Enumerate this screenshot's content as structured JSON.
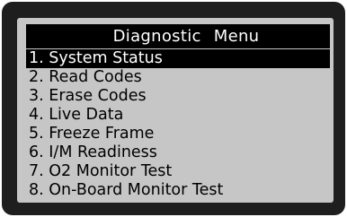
{
  "screen": {
    "title": "Diagnostic  Menu",
    "selected_index": 0,
    "menu_items": [
      "1. System Status",
      "2. Read Codes",
      "3. Erase Codes",
      "4. Live Data",
      "5. Freeze Frame",
      "6. I/M Readiness",
      "7. O2 Monitor Test",
      "8. On-Board Monitor Test"
    ]
  },
  "colors": {
    "bezel": "#1e1e1e",
    "screen_background": "#c6c6c6",
    "highlight": "#000000",
    "highlight_text": "#ffffff"
  }
}
